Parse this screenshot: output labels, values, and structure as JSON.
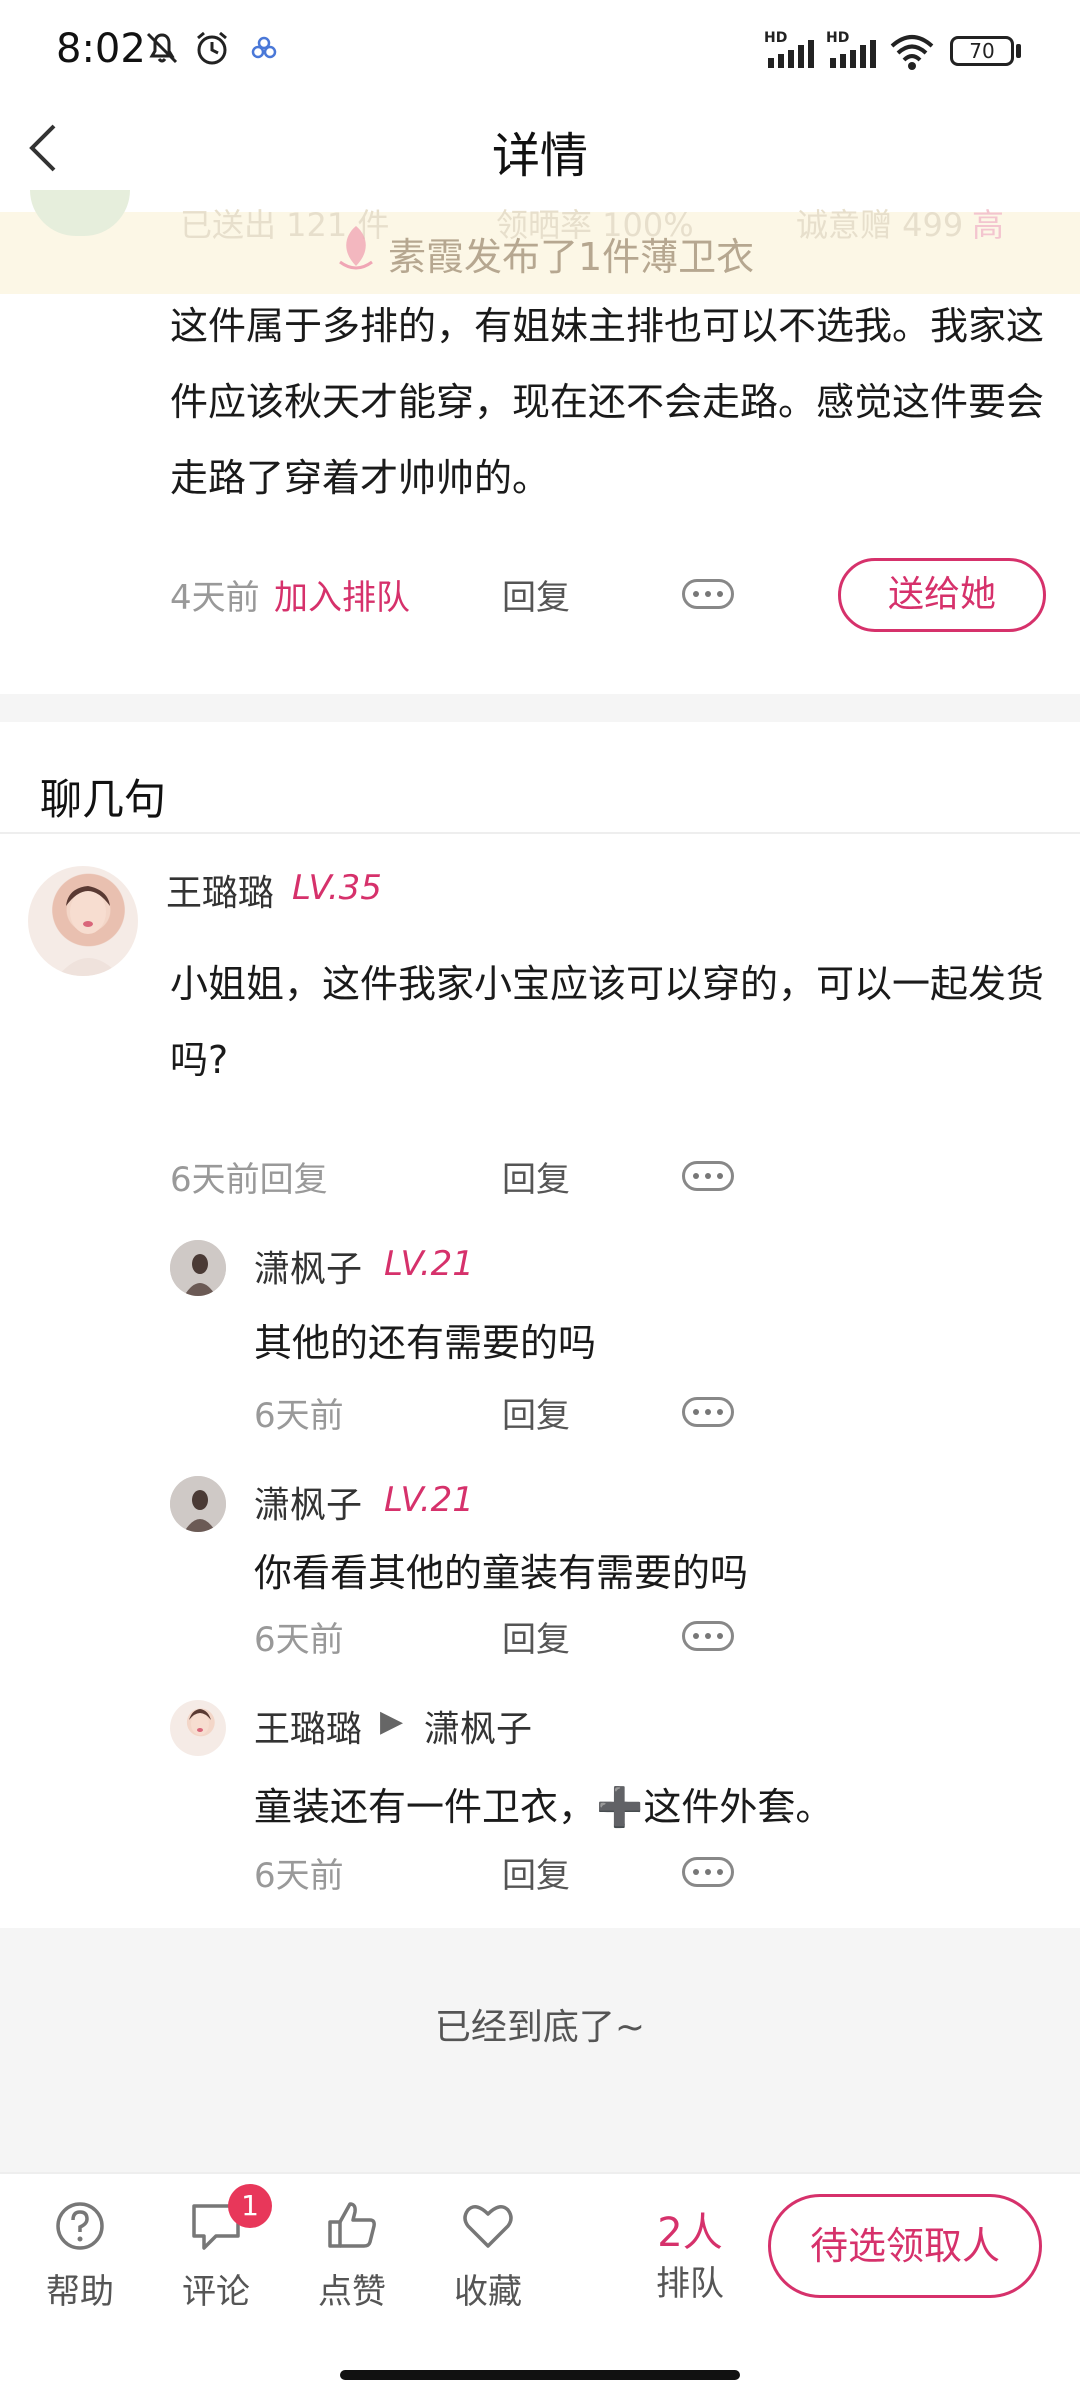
{
  "status_bar": {
    "time": "8:02",
    "battery": "70",
    "network_1": "HD",
    "network_2": "HD"
  },
  "header": {
    "title": "详情"
  },
  "banner": {
    "stat_sent": "已送出 121 件",
    "stat_rate": "领晒率 100%",
    "stat_gift": "诚意赠 499",
    "stat_level": "高",
    "notice": "素霞发布了1件薄卫衣"
  },
  "post_comment": {
    "text": "这件属于多排的，有姐妹主排也可以不选我。我家这件应该秋天才能穿，现在还不会走路。感觉这件要会走路了穿着才帅帅的。",
    "time": "4天前",
    "join_queue": "加入排队",
    "reply": "回复",
    "gift_button": "送给她"
  },
  "chat": {
    "heading": "聊几句",
    "main": {
      "name": "王璐璐",
      "level": "LV.35",
      "text": "小姐姐，这件我家小宝应该可以穿的，可以一起发货吗?",
      "time": "6天前回复",
      "reply": "回复"
    },
    "replies": [
      {
        "name": "潇枫子",
        "level": "LV.21",
        "text": "其他的还有需要的吗",
        "time": "6天前",
        "reply": "回复"
      },
      {
        "name": "潇枫子",
        "level": "LV.21",
        "text": "你看看其他的童装有需要的吗",
        "time": "6天前",
        "reply": "回复"
      },
      {
        "name": "王璐璐",
        "arrow": "▶",
        "target": "潇枫子",
        "text": "童装还有一件卫衣，➕这件外套。",
        "time": "6天前",
        "reply": "回复"
      }
    ]
  },
  "end_text": "已经到底了~",
  "tabbar": {
    "help": "帮助",
    "comment": "评论",
    "comment_badge": "1",
    "like": "点赞",
    "favorite": "收藏",
    "queue_count": "2人",
    "queue_label": "排队",
    "claim_button": "待选领取人"
  },
  "colors": {
    "accent": "#d6316b",
    "banner_bg": "#fcf7e6",
    "badge": "#e8375a"
  }
}
